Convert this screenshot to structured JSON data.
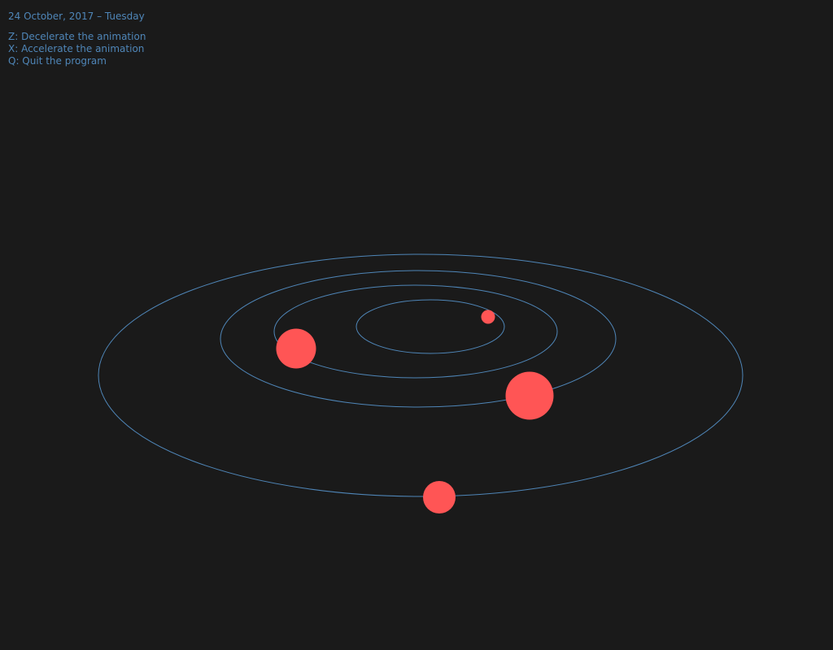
{
  "hud": {
    "date": "24 October, 2017 – Tuesday",
    "controls": [
      "Z: Decelerate the animation",
      "X: Accelerate the animation",
      "Q: Quit the program"
    ]
  },
  "colors": {
    "background": "#1a1a1a",
    "text": "#4f86b8",
    "orbit": "#4f86b8",
    "planet": "#ff5555"
  }
}
